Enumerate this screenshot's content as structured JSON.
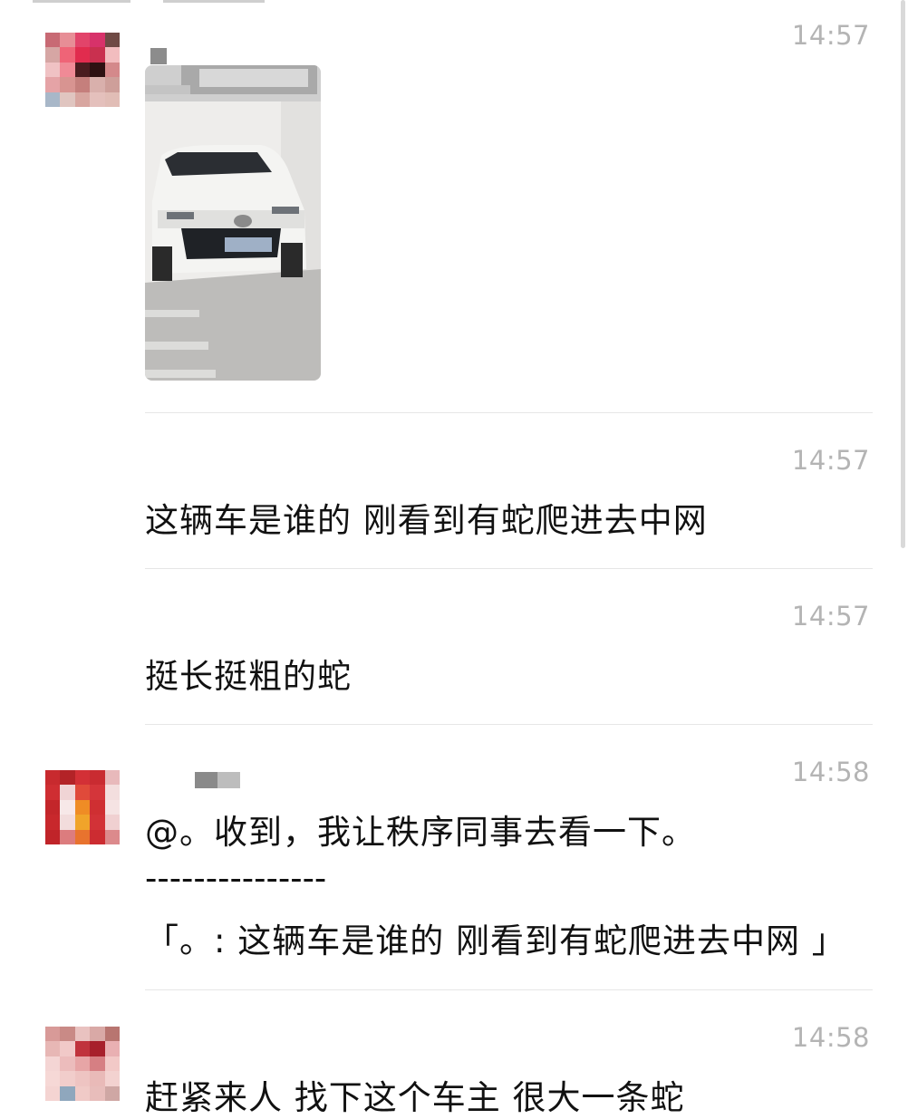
{
  "messages": [
    {
      "time": "14:57",
      "type": "image",
      "image_alt": "white SUV parked in garage"
    },
    {
      "time": "14:57",
      "type": "text",
      "text": "这辆车是谁的 刚看到有蛇爬进去中网"
    },
    {
      "time": "14:57",
      "type": "text",
      "text": "挺长挺粗的蛇"
    },
    {
      "time": "14:58",
      "type": "reply",
      "text": "@。收到，我让秩序同事去看一下。",
      "separator": "---------------",
      "quote": "「。: 这辆车是谁的 刚看到有蛇爬进去中网 」"
    },
    {
      "time": "14:58",
      "type": "text",
      "text": "赶紧来人 找下这个车主 很大一条蛇"
    }
  ],
  "colors": {
    "timestamp": "#b4b4b4",
    "text": "#111111",
    "divider": "#e6e6e6"
  }
}
